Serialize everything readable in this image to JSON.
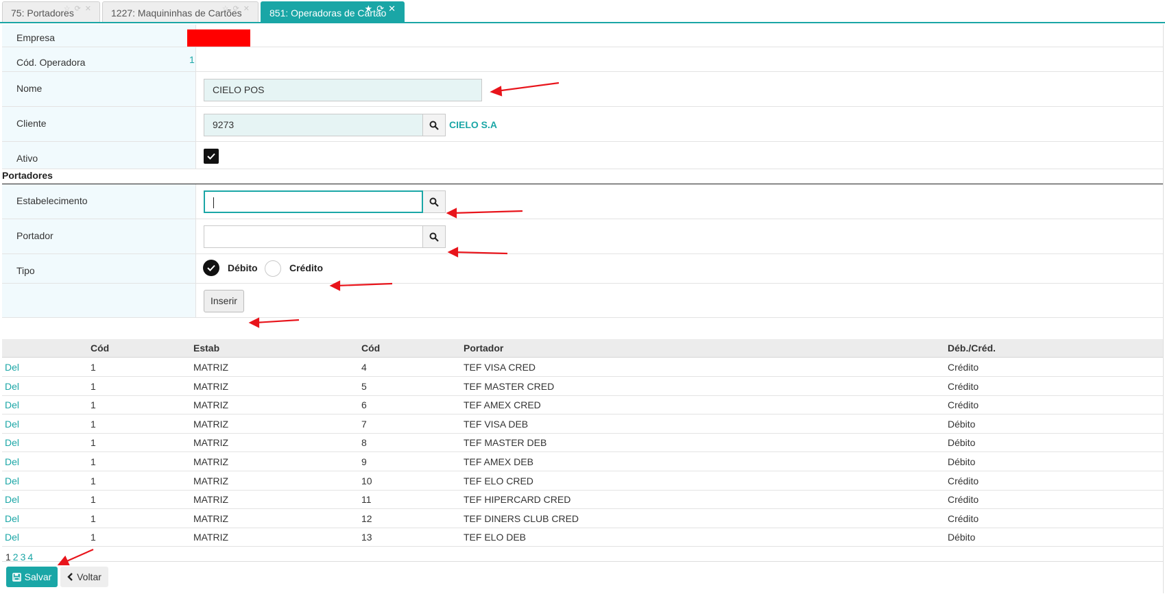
{
  "tabs": [
    {
      "label": "75: Portadores",
      "icons": [
        "star-outline-icon",
        "refresh-icon",
        "close-icon"
      ]
    },
    {
      "label": "1227: Maquininhas de Cartões",
      "icons": [
        "star-outline-icon",
        "refresh-icon",
        "close-icon"
      ]
    },
    {
      "label": "851: Operadoras de Cartão",
      "icons": [
        "star-icon",
        "refresh-icon",
        "close-icon"
      ],
      "active": true
    }
  ],
  "form": {
    "empresa_label": "Empresa",
    "cod_operadora_label": "Cód. Operadora",
    "cod_operadora_value": "1",
    "nome_label": "Nome",
    "nome_value": "CIELO POS",
    "cliente_label": "Cliente",
    "cliente_value": "9273",
    "cliente_name": "CIELO S.A",
    "ativo_label": "Ativo",
    "ativo_checked": true
  },
  "portadores": {
    "section_title": "Portadores",
    "estabelecimento_label": "Estabelecimento",
    "estabelecimento_value": "",
    "portador_label": "Portador",
    "portador_value": "",
    "tipo_label": "Tipo",
    "tipo_options": [
      "Débito",
      "Crédito"
    ],
    "tipo_selected": "Débito",
    "insert_label": "Inserir"
  },
  "table": {
    "headers": [
      "",
      "Cód",
      "Estab",
      "Cód",
      "Portador",
      "Déb./Créd."
    ],
    "rows": [
      {
        "action": "Del",
        "cod": "1",
        "estab": "MATRIZ",
        "cod_portador": "4",
        "portador": "TEF VISA CRED",
        "tipo": "Crédito"
      },
      {
        "action": "Del",
        "cod": "1",
        "estab": "MATRIZ",
        "cod_portador": "5",
        "portador": "TEF MASTER CRED",
        "tipo": "Crédito"
      },
      {
        "action": "Del",
        "cod": "1",
        "estab": "MATRIZ",
        "cod_portador": "6",
        "portador": "TEF AMEX CRED",
        "tipo": "Crédito"
      },
      {
        "action": "Del",
        "cod": "1",
        "estab": "MATRIZ",
        "cod_portador": "7",
        "portador": "TEF VISA DEB",
        "tipo": "Débito"
      },
      {
        "action": "Del",
        "cod": "1",
        "estab": "MATRIZ",
        "cod_portador": "8",
        "portador": "TEF MASTER DEB",
        "tipo": "Débito"
      },
      {
        "action": "Del",
        "cod": "1",
        "estab": "MATRIZ",
        "cod_portador": "9",
        "portador": "TEF AMEX DEB",
        "tipo": "Débito"
      },
      {
        "action": "Del",
        "cod": "1",
        "estab": "MATRIZ",
        "cod_portador": "10",
        "portador": "TEF ELO CRED",
        "tipo": "Crédito"
      },
      {
        "action": "Del",
        "cod": "1",
        "estab": "MATRIZ",
        "cod_portador": "11",
        "portador": "TEF HIPERCARD CRED",
        "tipo": "Crédito"
      },
      {
        "action": "Del",
        "cod": "1",
        "estab": "MATRIZ",
        "cod_portador": "12",
        "portador": "TEF DINERS CLUB CRED",
        "tipo": "Crédito"
      },
      {
        "action": "Del",
        "cod": "1",
        "estab": "MATRIZ",
        "cod_portador": "13",
        "portador": "TEF ELO DEB",
        "tipo": "Débito"
      }
    ]
  },
  "pagination": {
    "pages": [
      "1",
      "2",
      "3",
      "4"
    ],
    "current": "1"
  },
  "footer": {
    "save_label": "Salvar",
    "back_label": "Voltar"
  },
  "colors": {
    "accent": "#1aa6a6",
    "annotation_arrow": "#e8141b",
    "redaction": "#ff0000"
  }
}
